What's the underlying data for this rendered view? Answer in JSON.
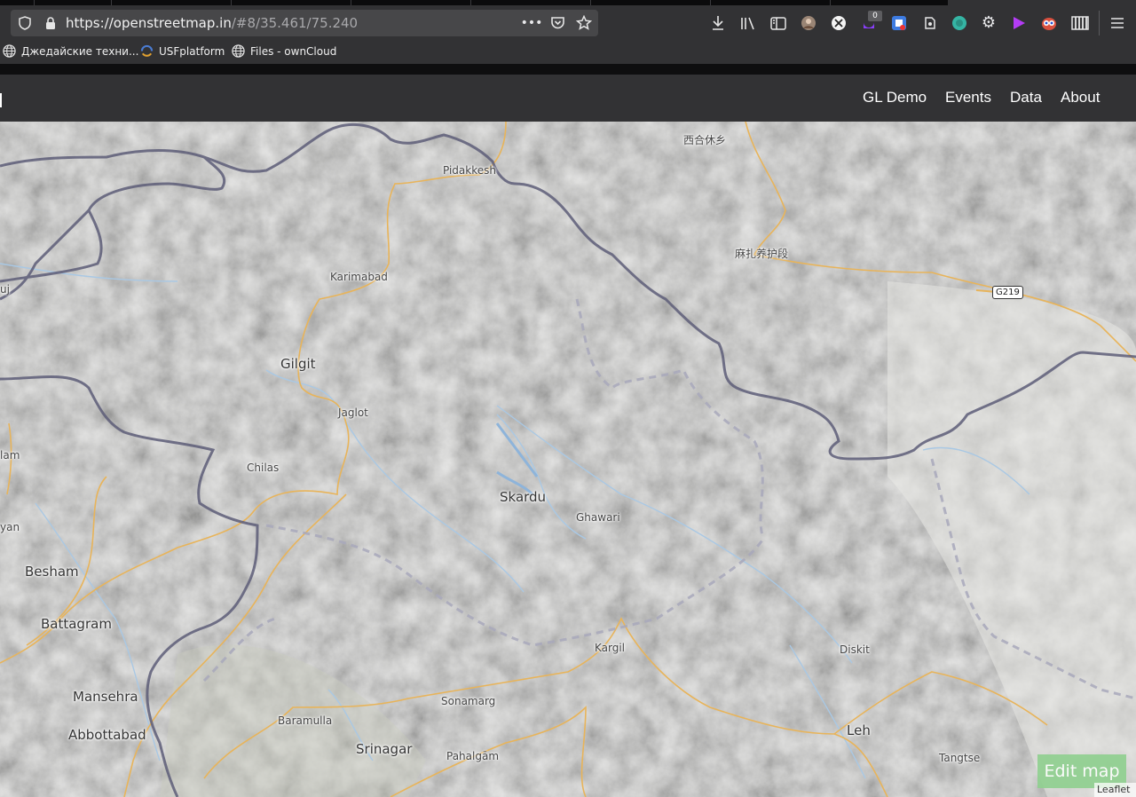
{
  "browser": {
    "url_host": "https://openstreetmap.in",
    "url_path": "/#8/35.461/75.240",
    "toolbar_icons": [
      "shield-icon",
      "lock-icon",
      "more-icon",
      "pocket-icon",
      "star-icon",
      "download-icon",
      "library-icon",
      "sidebar-icon",
      "avatar-icon",
      "extension-x-icon",
      "extension-badge-icon",
      "extension-box-icon",
      "evernote-icon",
      "extension-circle-icon",
      "gear-icon",
      "play-icon",
      "owl-icon",
      "piano-icon",
      "menu-icon"
    ],
    "extension_badge": "0",
    "bookmarks": [
      {
        "label": "Джедайские техни..."
      },
      {
        "label": "USFplatform"
      },
      {
        "label": "Files - ownCloud"
      }
    ]
  },
  "site": {
    "nav": [
      "GL Demo",
      "Events",
      "Data",
      "About"
    ]
  },
  "map": {
    "labels": {
      "xihe": "西合休乡",
      "pidakkesh": "Pidakkesh",
      "mazha": "麻扎养护段",
      "karimabad": "Karimabad",
      "uj": "uj",
      "gilgit": "Gilgit",
      "jaglot": "Jaglot",
      "lam": "lam",
      "chilas": "Chilas",
      "skardu": "Skardu",
      "ghawari": "Ghawari",
      "yan": "yan",
      "besham": "Besham",
      "battagram": "Battagram",
      "kargil": "Kargil",
      "diskit": "Diskit",
      "mansehra": "Mansehra",
      "sonamarg": "Sonamarg",
      "baramulla": "Baramulla",
      "abbottabad": "Abbottabad",
      "leh": "Leh",
      "srinagar": "Srinagar",
      "pahalgam": "Pahalgām",
      "tangtse": "Tangtse"
    },
    "road_shield": "G219",
    "edit_button": "Edit map",
    "attribution": "Leaflet"
  },
  "colors": {
    "border": "#5d5d78",
    "disputed": "#a8a8bb",
    "road": "#e8b45a",
    "water": "#a9c8e4",
    "terrain": "#d4d4d2"
  }
}
